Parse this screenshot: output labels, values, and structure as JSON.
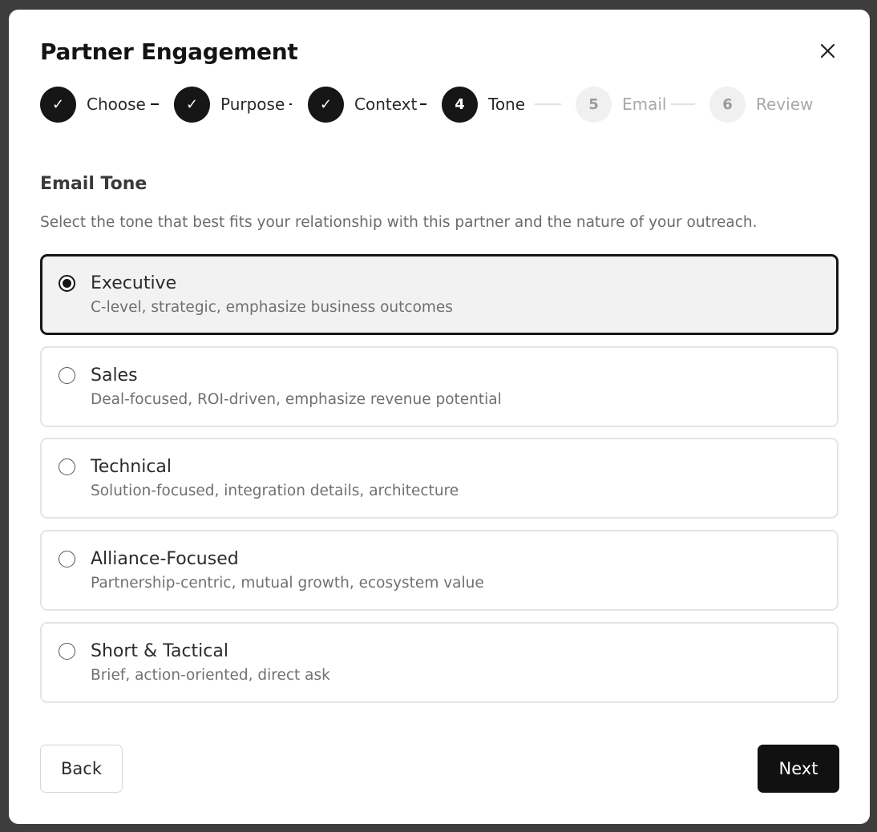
{
  "modal": {
    "title": "Partner Engagement",
    "close_icon": "close-icon"
  },
  "stepper": {
    "steps": [
      {
        "label": "Choose",
        "marker": "✓",
        "state": "done"
      },
      {
        "label": "Purpose",
        "marker": "✓",
        "state": "done"
      },
      {
        "label": "Context",
        "marker": "✓",
        "state": "done"
      },
      {
        "label": "Tone",
        "marker": "4",
        "state": "active"
      },
      {
        "label": "Email",
        "marker": "5",
        "state": "todo"
      },
      {
        "label": "Review",
        "marker": "6",
        "state": "todo"
      }
    ]
  },
  "section": {
    "title": "Email Tone",
    "description": "Select the tone that best fits your relationship with this partner and the nature of your outreach."
  },
  "options": [
    {
      "title": "Executive",
      "description": "C-level, strategic, emphasize business outcomes",
      "selected": true
    },
    {
      "title": "Sales",
      "description": "Deal-focused, ROI-driven, emphasize revenue potential",
      "selected": false
    },
    {
      "title": "Technical",
      "description": "Solution-focused, integration details, architecture",
      "selected": false
    },
    {
      "title": "Alliance-Focused",
      "description": "Partnership-centric, mutual growth, ecosystem value",
      "selected": false
    },
    {
      "title": "Short & Tactical",
      "description": "Brief, action-oriented, direct ask",
      "selected": false
    }
  ],
  "footer": {
    "back_label": "Back",
    "next_label": "Next"
  },
  "colors": {
    "primary": "#161616",
    "selected_bg": "#f2f2f2",
    "muted_text": "#a8a8a8",
    "overlay": "#3d3d3d"
  }
}
